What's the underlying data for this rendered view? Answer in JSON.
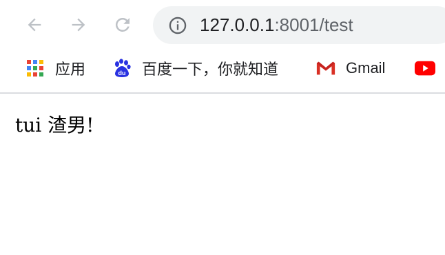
{
  "toolbar": {
    "url_host": "127.0.0.1",
    "url_rest": ":8001/test",
    "icons": [
      "back-icon",
      "forward-icon",
      "reload-icon",
      "info-icon"
    ]
  },
  "bookmarks": [
    {
      "label": "应用",
      "icon": "apps-grid-icon"
    },
    {
      "label": "百度一下，你就知道",
      "icon": "baidu-paw-icon"
    },
    {
      "label": "Gmail",
      "icon": "gmail-icon"
    },
    {
      "label": "",
      "icon": "youtube-icon"
    }
  ],
  "page": {
    "text": "tui 渣男!"
  },
  "colors": {
    "omnibox_bg": "#f1f3f4",
    "divider": "#dadce0",
    "youtube_red": "#ff0000",
    "baidu_blue": "#2932e1",
    "gmail_red": "#d93025"
  }
}
